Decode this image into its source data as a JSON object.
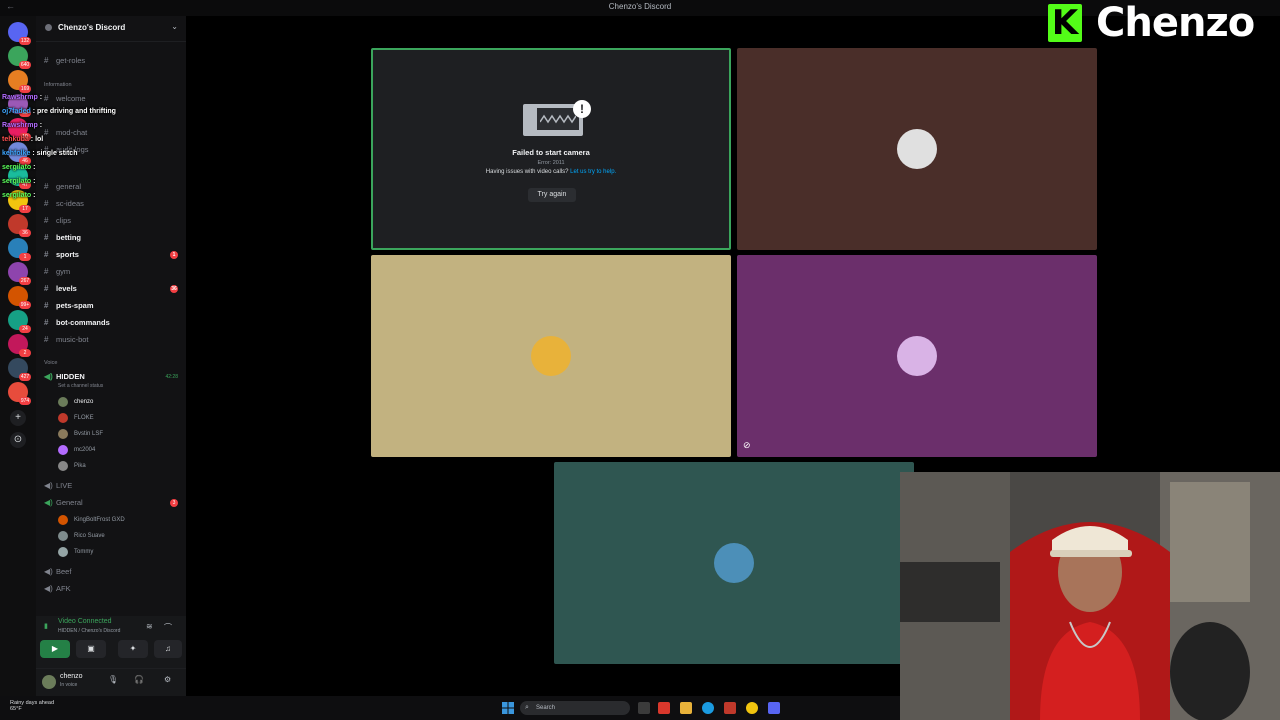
{
  "window": {
    "title": "Chenzo's Discord"
  },
  "server": {
    "name": "Chenzo's Discord"
  },
  "rail": {
    "servers": [
      {
        "color": "#5865f2",
        "badge": "132"
      },
      {
        "color": "#3ba55c",
        "badge": "640"
      },
      {
        "color": "#e67e22",
        "badge": "169"
      },
      {
        "color": "#9b59b6",
        "badge": "38"
      },
      {
        "color": "#e91e63",
        "badge": "10"
      },
      {
        "color": "#7289da",
        "badge": "46"
      },
      {
        "color": "#1abc9c",
        "badge": "47"
      },
      {
        "color": "#f1c40f",
        "badge": "17"
      },
      {
        "color": "#c0392b",
        "badge": "36"
      },
      {
        "color": "#2980b9",
        "badge": "1"
      },
      {
        "color": "#8e44ad",
        "badge": "267"
      },
      {
        "color": "#d35400",
        "badge": "99+"
      },
      {
        "color": "#16a085",
        "badge": "24"
      },
      {
        "color": "#c2185b",
        "badge": "2"
      },
      {
        "color": "#34495e",
        "badge": "427"
      },
      {
        "color": "#e74c3c",
        "badge": "974"
      }
    ],
    "add_label": "+",
    "discover_label": "⊙"
  },
  "channels": {
    "get_roles": "get-roles",
    "cat_info": "Information",
    "welcome": "welcome",
    "mod_chat": "mod-chat",
    "audit_logs": "audit-logs",
    "general": "general",
    "sc_ideas": "sc-ideas",
    "clips": "clips",
    "betting": "betting",
    "sports": "sports",
    "sports_badge": "1",
    "gym": "gym",
    "levels": "levels",
    "levels_badge": "36",
    "pets_spam": "pets-spam",
    "bot_commands": "bot-commands",
    "music_bot": "music-bot",
    "cat_voice": "Voice",
    "hidden": "HIDDEN",
    "hidden_timer": "42:28",
    "hidden_status": "Set a channel status",
    "hidden_users": [
      "chenzo",
      "FLOKE",
      "Bvstin",
      "mc2004",
      "Pika"
    ],
    "bvstin_tag": "LSF",
    "live": "LIVE",
    "general_voice": "General",
    "general_badge": "3",
    "general_users": [
      "KingBoltFrost",
      "Rico Suave",
      "Tommy"
    ],
    "kingbolt_tag": "GXD",
    "beef": "Beef",
    "afk": "AFK"
  },
  "voice_panel": {
    "status": "Video Connected",
    "sub": "HIDDEN / Chenzo's Discord"
  },
  "user": {
    "name": "chenzo",
    "status": "In voice"
  },
  "chat": [
    {
      "user": "Rawshrmp",
      "text": ":",
      "color": "#b36bff"
    },
    {
      "user": "oj7faded",
      "text": ": pre driving and thrifting",
      "color": "#3ea6ff"
    },
    {
      "user": "Rawshrmp",
      "text": ":",
      "color": "#b36bff"
    },
    {
      "user": "tehkuba",
      "text": ": lol",
      "color": "#ff4f4f"
    },
    {
      "user": "kehfolke",
      "text": ": single stitch",
      "color": "#3ea6ff"
    },
    {
      "user": "sergilato",
      "text": ":",
      "color": "#5cff5c"
    },
    {
      "user": "sergilato",
      "text": ":",
      "color": "#5cff5c"
    },
    {
      "user": "sergilato",
      "text": ":",
      "color": "#5cff5c"
    }
  ],
  "camera_fail": {
    "heading": "Failed to start camera",
    "error": "Error: 2011",
    "help_prefix": "Having issues with video calls?",
    "help_link": "Let us try to help.",
    "retry": "Try again"
  },
  "tiles": [
    {
      "color": "#1e1f22",
      "border": "#3ba55c"
    },
    {
      "color": "#4a2e29",
      "avatar": "#e0e0e0"
    },
    {
      "color": "#c2b280",
      "avatar": "#e8b23a"
    },
    {
      "color": "#6b2f6b",
      "avatar": "#d9b3e6"
    },
    {
      "color": "#2f5651",
      "avatar": "#4c8fb8"
    }
  ],
  "logo": {
    "letter": "K",
    "name": "Chenzo"
  },
  "taskbar": {
    "weather": "Rainy days ahead",
    "temp": "65°F",
    "search": "Search"
  }
}
